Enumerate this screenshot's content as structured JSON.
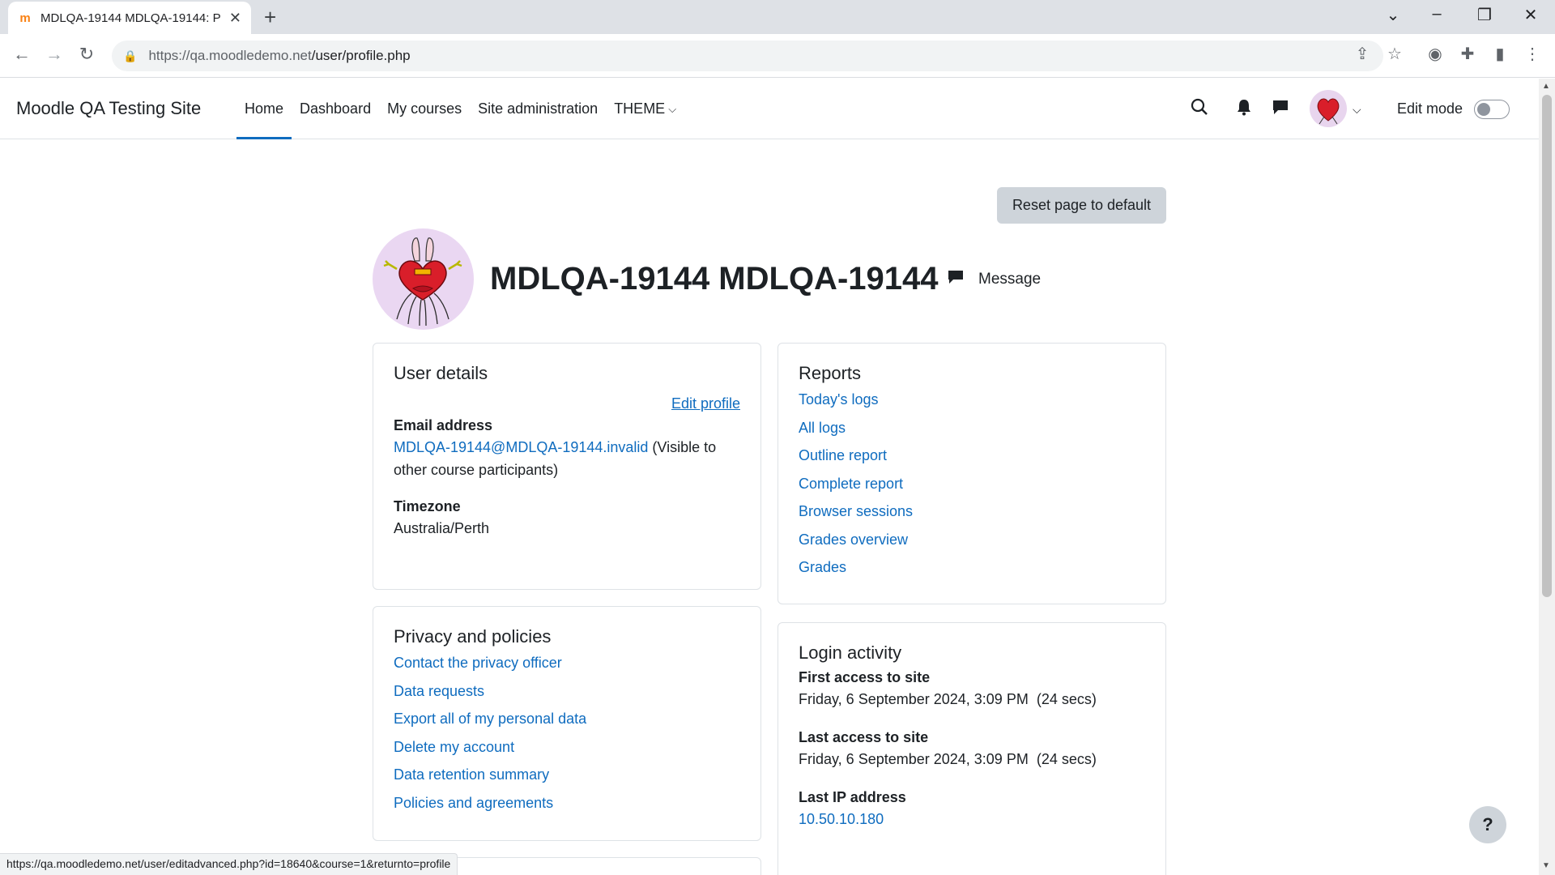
{
  "browser": {
    "tab_title": "MDLQA-19144 MDLQA-19144: P",
    "tab_favicon": "moodle-m",
    "url_host": "https://qa.moodledemo.net",
    "url_path": "/user/profile.php",
    "status_url": "https://qa.moodledemo.net/user/editadvanced.php?id=18640&course=1&returnto=profile"
  },
  "navbar": {
    "site_name": "Moodle QA Testing Site",
    "items": [
      {
        "label": "Home",
        "active": true
      },
      {
        "label": "Dashboard",
        "active": false
      },
      {
        "label": "My courses",
        "active": false
      },
      {
        "label": "Site administration",
        "active": false
      },
      {
        "label": "THEME",
        "active": false
      }
    ],
    "edit_mode_label": "Edit mode"
  },
  "page": {
    "reset_button": "Reset page to default",
    "profile_name": "MDLQA-19144 MDLQA-19144",
    "message_label": "Message"
  },
  "user_details": {
    "title": "User details",
    "edit_profile": "Edit profile",
    "email_label": "Email address",
    "email_value": "MDLQA-19144@MDLQA-19144.invalid",
    "email_visibility_line1": " (Visible to",
    "email_visibility_line2": "other course participants)",
    "timezone_label": "Timezone",
    "timezone_value": "Australia/Perth"
  },
  "privacy": {
    "title": "Privacy and policies",
    "links": [
      "Contact the privacy officer",
      "Data requests",
      "Export all of my personal data",
      "Delete my account",
      "Data retention summary",
      "Policies and agreements"
    ]
  },
  "reports": {
    "title": "Reports",
    "links": [
      "Today's logs",
      "All logs",
      "Outline report",
      "Complete report",
      "Browser sessions",
      "Grades overview",
      "Grades"
    ]
  },
  "login_activity": {
    "title": "Login activity",
    "first_access_label": "First access to site",
    "first_access_value": "Friday, 6 September 2024, 3:09 PM  (24 secs)",
    "last_access_label": "Last access to site",
    "last_access_value": "Friday, 6 September 2024, 3:09 PM  (24 secs)",
    "last_ip_label": "Last IP address",
    "last_ip_value": "10.50.10.180"
  },
  "help_button": "?"
}
